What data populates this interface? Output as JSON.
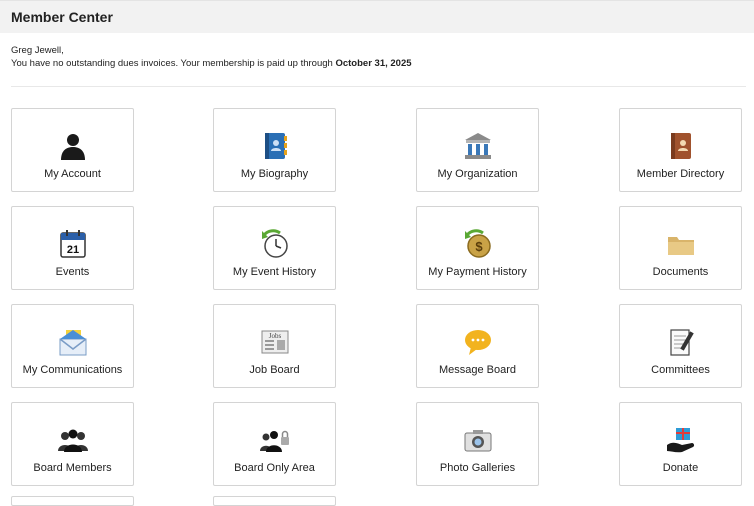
{
  "header": {
    "title": "Member Center"
  },
  "intro": {
    "name": "Greg Jewell,",
    "line2": "You have no outstanding dues invoices.  Your membership is paid up through ",
    "paid_through": "October 31, 2025"
  },
  "tiles": [
    {
      "label": "My Account",
      "icon": "person-silhouette-icon"
    },
    {
      "label": "My Biography",
      "icon": "address-book-icon"
    },
    {
      "label": "My Organization",
      "icon": "building-icon"
    },
    {
      "label": "Member Directory",
      "icon": "directory-book-icon"
    },
    {
      "label": "Events",
      "icon": "calendar-icon",
      "icon_text": "21"
    },
    {
      "label": "My Event History",
      "icon": "clock-history-icon"
    },
    {
      "label": "My Payment History",
      "icon": "dollar-history-icon",
      "icon_text": "$"
    },
    {
      "label": "Documents",
      "icon": "folder-icon"
    },
    {
      "label": "My Communications",
      "icon": "mail-envelope-icon"
    },
    {
      "label": "Job Board",
      "icon": "newspaper-icon",
      "icon_text": "Jobs"
    },
    {
      "label": "Message Board",
      "icon": "speech-bubble-icon"
    },
    {
      "label": "Committees",
      "icon": "notepad-pen-icon"
    },
    {
      "label": "Board Members",
      "icon": "group-people-icon"
    },
    {
      "label": "Board Only Area",
      "icon": "group-lock-icon"
    },
    {
      "label": "Photo Galleries",
      "icon": "camera-icon"
    },
    {
      "label": "Donate",
      "icon": "gift-hand-icon"
    }
  ]
}
